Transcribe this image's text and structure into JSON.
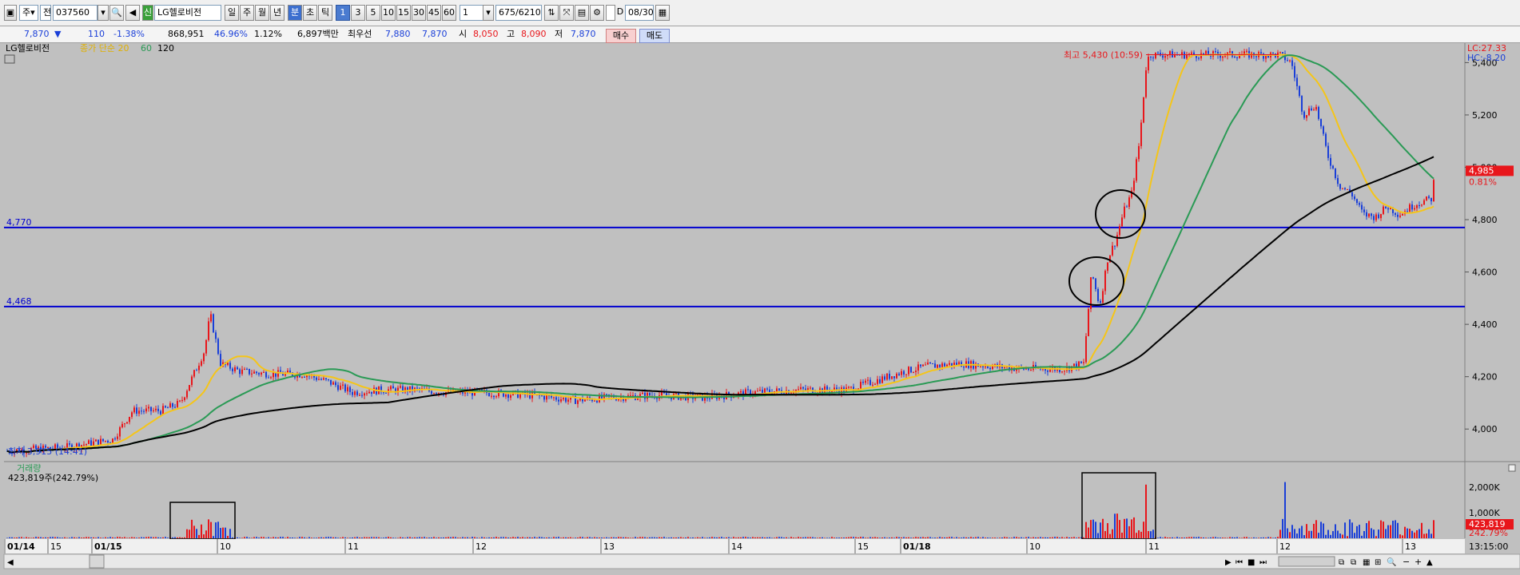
{
  "toolbar": {
    "market_toggle": "주",
    "type_toggle": "전",
    "code": "037560",
    "name_badge": "신",
    "stock_name": "LG헬로비전",
    "period_buttons": [
      "일",
      "주",
      "월",
      "년",
      "분",
      "초",
      "틱"
    ],
    "interval_buttons": [
      "1",
      "3",
      "5",
      "10",
      "15",
      "30",
      "45",
      "60"
    ],
    "interval_value": "1",
    "count_value": "675/6210",
    "d_label": "D",
    "date_value": "08/30"
  },
  "quote": {
    "price": "7,870",
    "change_arrow": "▼",
    "change": "110",
    "change_rate": "-1.38%",
    "volume": "868,951",
    "volume_rate": "46.96%",
    "turnover_rate": "1.12%",
    "trade_amount": "6,897백만",
    "pref_label": "최우선",
    "ask": "7,880",
    "bid": "7,870",
    "open_label": "시",
    "open": "8,050",
    "high_label": "고",
    "high": "8,090",
    "low_label": "저",
    "low": "7,870",
    "buy_button": "매수",
    "sell_button": "매도"
  },
  "legend": {
    "name": "LG헬로비전",
    "ma_hidden": "종가 단순 20",
    "ma60": "60",
    "ma120": "120"
  },
  "colors": {
    "up": "#e8161b",
    "down": "#1a3fd8",
    "ma20": "#f5c518",
    "ma60": "#2a9a55",
    "ma120": "#000000",
    "line": "#0000d0"
  },
  "price_axis": {
    "ticks": [
      "5,400",
      "5,200",
      "5,000",
      "4,800",
      "4,600",
      "4,400",
      "4,200",
      "4,000"
    ],
    "lc": "LC:27.33",
    "hc": "HC:-8.20",
    "current_price": "4,985",
    "current_rate": "0.81%"
  },
  "annotations": {
    "high_text": "최고 5,430 (10:59)",
    "low_text": "최저 3,915 (14:41)",
    "line1_label": "4,770",
    "line2_label": "4,468"
  },
  "volume_panel": {
    "title": "거래량",
    "value_text": "423,819주(242.79%)",
    "ticks": [
      "2,000K",
      "1,000K"
    ],
    "badge_value": "423,819",
    "badge_rate": "242.79%"
  },
  "time_axis": {
    "labels": [
      "01/14",
      "15",
      "01/15",
      "10",
      "11",
      "12",
      "13",
      "14",
      "15",
      "01/18",
      "10",
      "11",
      "12",
      "13"
    ],
    "end_time": "13:15:00"
  },
  "chart_data": {
    "type": "candlestick",
    "price_range": [
      3900,
      5450
    ],
    "horizontal_lines": [
      4770,
      4468
    ],
    "high": {
      "value": 5430,
      "time": "10:59"
    },
    "low": {
      "value": 3915,
      "time": "14:41"
    },
    "last_close": 4985,
    "volume_range": [
      0,
      2500000
    ],
    "volume_last": 423819
  }
}
